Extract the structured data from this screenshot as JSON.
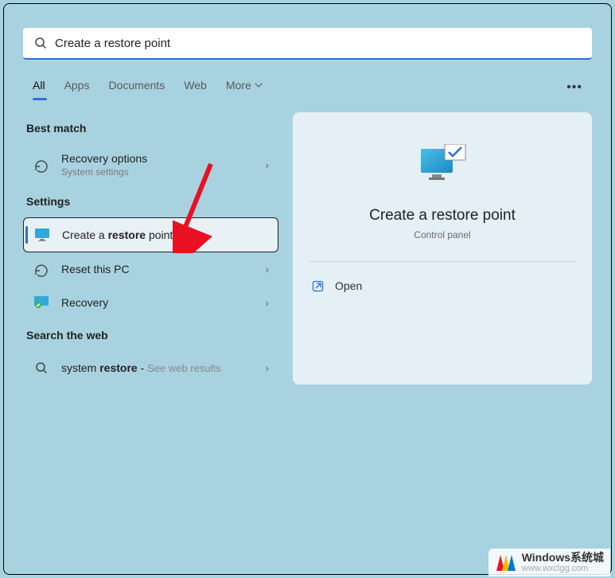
{
  "search": {
    "value": "Create a restore point"
  },
  "tabs": {
    "all": "All",
    "apps": "Apps",
    "documents": "Documents",
    "web": "Web",
    "more": "More"
  },
  "sections": {
    "best_match": "Best match",
    "settings": "Settings",
    "search_web": "Search the web"
  },
  "results": {
    "recovery_options": {
      "title": "Recovery options",
      "sub": "System settings"
    },
    "create_restore": {
      "prefix": "Create a ",
      "bold": "restore",
      "suffix": " point"
    },
    "reset_pc": {
      "title": "Reset this PC"
    },
    "recovery": {
      "title": "Recovery"
    },
    "web_restore": {
      "prefix": "system ",
      "bold": "restore",
      "suffix": " - ",
      "hint": "See web results"
    }
  },
  "panel": {
    "title": "Create a restore point",
    "sub": "Control panel",
    "open": "Open"
  },
  "watermark": {
    "line1": "Windows系统城",
    "line2": "www.wxclgg.com"
  }
}
